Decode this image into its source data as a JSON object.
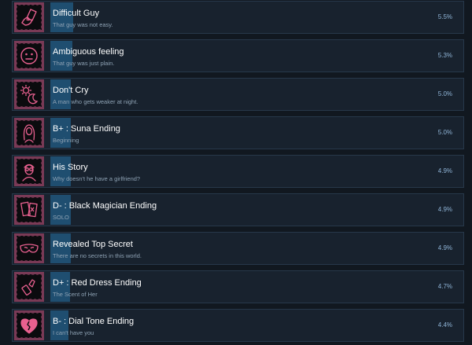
{
  "achievements": [
    {
      "title": "Difficult Guy",
      "desc": "That guy was not easy.",
      "percent_label": "5.5%",
      "percent": 5.5,
      "icon": "hand-card-icon"
    },
    {
      "title": "Ambiguous feeling",
      "desc": "That guy was just plain.",
      "percent_label": "5.3%",
      "percent": 5.3,
      "icon": "neutral-face-icon"
    },
    {
      "title": "Don't Cry",
      "desc": "A man who gets weaker at night.",
      "percent_label": "5.0%",
      "percent": 5.0,
      "icon": "sun-moon-icon"
    },
    {
      "title": "B+ : Suna Ending",
      "desc": "Beginning",
      "percent_label": "5.0%",
      "percent": 5.0,
      "icon": "woman-portrait-icon"
    },
    {
      "title": "His Story",
      "desc": "Why doesn't he have a girlfriend?",
      "percent_label": "4.9%",
      "percent": 4.9,
      "icon": "man-glasses-icon"
    },
    {
      "title": "D- : Black Magician Ending",
      "desc": "SOLO",
      "percent_label": "4.9%",
      "percent": 4.9,
      "icon": "tarot-cards-icon"
    },
    {
      "title": "Revealed Top Secret",
      "desc": "There are no secrets in this world.",
      "percent_label": "4.9%",
      "percent": 4.9,
      "icon": "mask-icon"
    },
    {
      "title": "D+ : Red Dress Ending",
      "desc": "The Scent of Her",
      "percent_label": "4.7%",
      "percent": 4.7,
      "icon": "lipstick-icon"
    },
    {
      "title": "B- : Dial Tone Ending",
      "desc": "I can't have you",
      "percent_label": "4.4%",
      "percent": 4.4,
      "icon": "broken-heart-icon"
    }
  ],
  "colors": {
    "accent_progress": "#1f4e70",
    "icon_line": "#e8608f",
    "frame": "#7a3a56"
  }
}
